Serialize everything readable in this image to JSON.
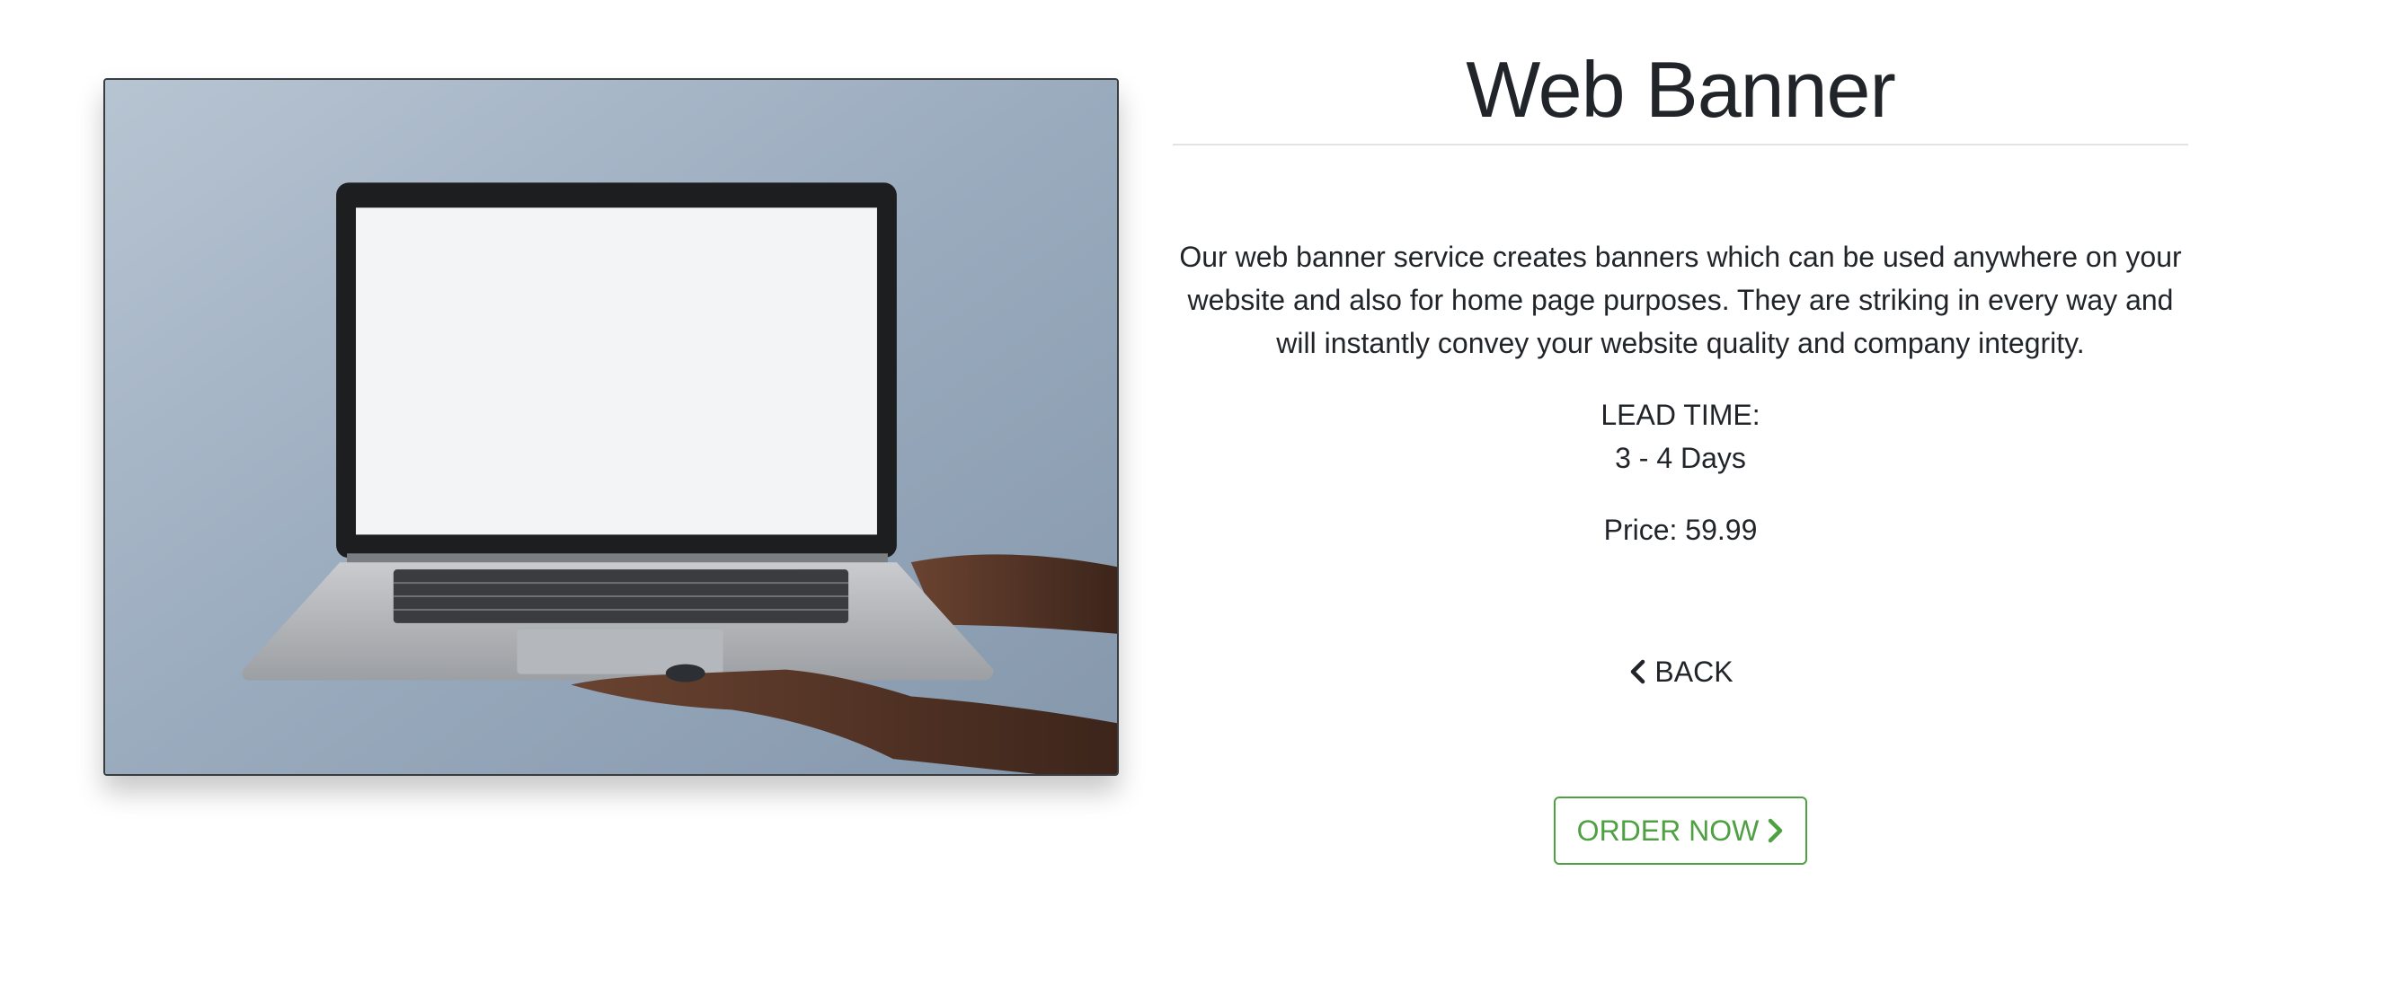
{
  "product": {
    "title": "Web Banner",
    "description": "Our web banner service creates banners which can be used anywhere on your website and also for home page purposes. They are striking in every way and will instantly convey your website quality and company integrity.",
    "lead_time_label": "LEAD TIME:",
    "lead_time_value": "3 - 4 Days",
    "price_label": "Price: 59.99",
    "image_icon": "laptop-photo"
  },
  "actions": {
    "back_label": "BACK",
    "back_icon": "chevron-left-icon",
    "order_label": "ORDER NOW",
    "order_icon": "chevron-right-icon"
  },
  "colors": {
    "accent_green": "#4ea042",
    "text": "#212529",
    "divider": "#e3e3e3"
  }
}
